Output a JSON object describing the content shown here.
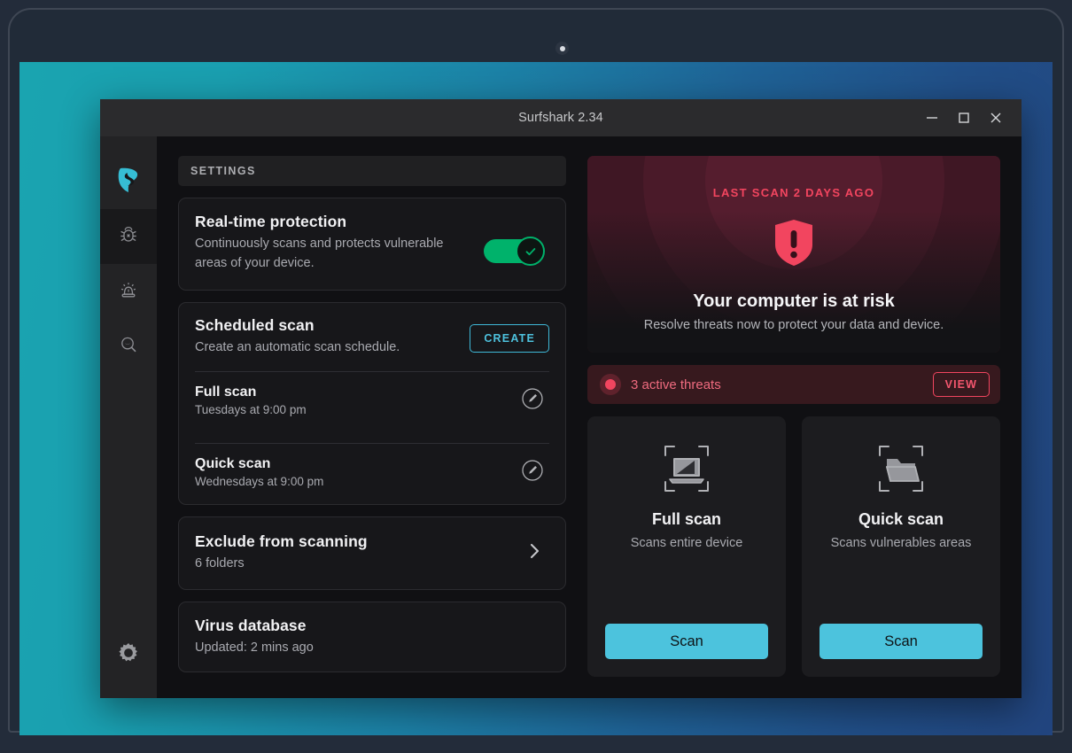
{
  "window": {
    "title": "Surfshark 2.34",
    "controls": [
      {
        "name": "minimize",
        "label": "–"
      },
      {
        "name": "maximize",
        "label": "□"
      },
      {
        "name": "close",
        "label": "✕"
      }
    ]
  },
  "sidebar": {
    "items": [
      {
        "icon": "surfshark-logo-icon",
        "label": "Surfshark",
        "active": false
      },
      {
        "icon": "bug-icon",
        "label": "Antivirus",
        "active": true
      },
      {
        "icon": "alert-siren-icon",
        "label": "Alert",
        "active": false
      },
      {
        "icon": "search-shark-icon",
        "label": "Search",
        "active": false
      }
    ],
    "bottom": {
      "icon": "gear-icon",
      "label": "Settings"
    }
  },
  "settings": {
    "header": "SETTINGS",
    "realtime": {
      "title": "Real-time protection",
      "description": "Continuously scans and protects vulnerable areas of your device.",
      "toggle_on": true
    },
    "scheduled": {
      "title": "Scheduled scan",
      "description": "Create an automatic scan schedule.",
      "create_label": "CREATE",
      "rows": [
        {
          "name": "Full scan",
          "when": "Tuesdays at 9:00 pm"
        },
        {
          "name": "Quick scan",
          "when": "Wednesdays at 9:00 pm"
        }
      ]
    },
    "exclude": {
      "title": "Exclude from scanning",
      "description": "6 folders"
    },
    "database": {
      "title": "Virus database",
      "description": "Updated: 2 mins ago"
    }
  },
  "status": {
    "last_scan": "LAST SCAN 2 DAYS AGO",
    "risk_title": "Your computer is at risk",
    "risk_description": "Resolve threats now to protect your data and device.",
    "threats": {
      "label": "3 active threats",
      "count": 3,
      "view_label": "VIEW"
    },
    "scans": [
      {
        "icon": "laptop-scan-icon",
        "title": "Full scan",
        "description": "Scans entire device",
        "button": "Scan"
      },
      {
        "icon": "folder-scan-icon",
        "title": "Quick scan",
        "description": "Scans vulnerables areas",
        "button": "Scan"
      }
    ]
  },
  "colors": {
    "accent_teal": "#4cc3dd",
    "brand_teal": "#36b9cf",
    "danger_red": "#f2455f",
    "toggle_green": "#00b26b",
    "window_bg": "#0c0c0e"
  }
}
